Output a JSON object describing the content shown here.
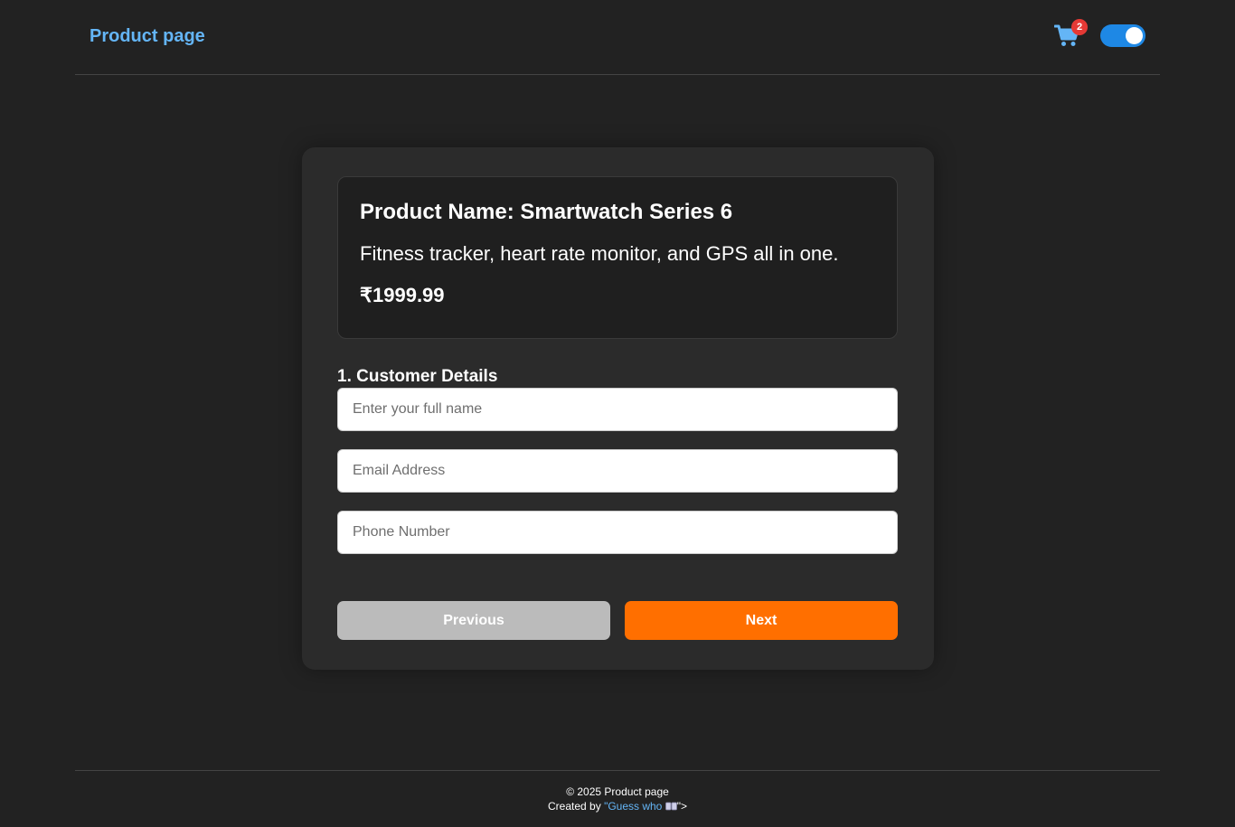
{
  "header": {
    "brand": "Product page",
    "cart_count": "2",
    "theme_toggle_on": true,
    "cart_icon": "cart-icon"
  },
  "product": {
    "name": "Product Name: Smartwatch Series 6",
    "description": "Fitness tracker, heart rate monitor, and GPS all in one.",
    "price": "₹1999.99"
  },
  "form": {
    "section_title": "1. Customer Details",
    "name_placeholder": "Enter your full name",
    "email_placeholder": "Email Address",
    "phone_placeholder": "Phone Number",
    "name_value": "",
    "email_value": "",
    "phone_value": ""
  },
  "buttons": {
    "previous": "Previous",
    "next": "Next"
  },
  "footer": {
    "copyright": "© 2025 Product page",
    "created_by_prefix": "Created by ",
    "author_link": "\"Guess who ",
    "suffix": "\">"
  },
  "colors": {
    "background": "#222222",
    "accent_blue": "#64b5f6",
    "toggle_blue": "#1e88e5",
    "next_orange": "#ff6f00",
    "previous_gray": "#bbbbbb",
    "badge_red": "#e53935"
  }
}
